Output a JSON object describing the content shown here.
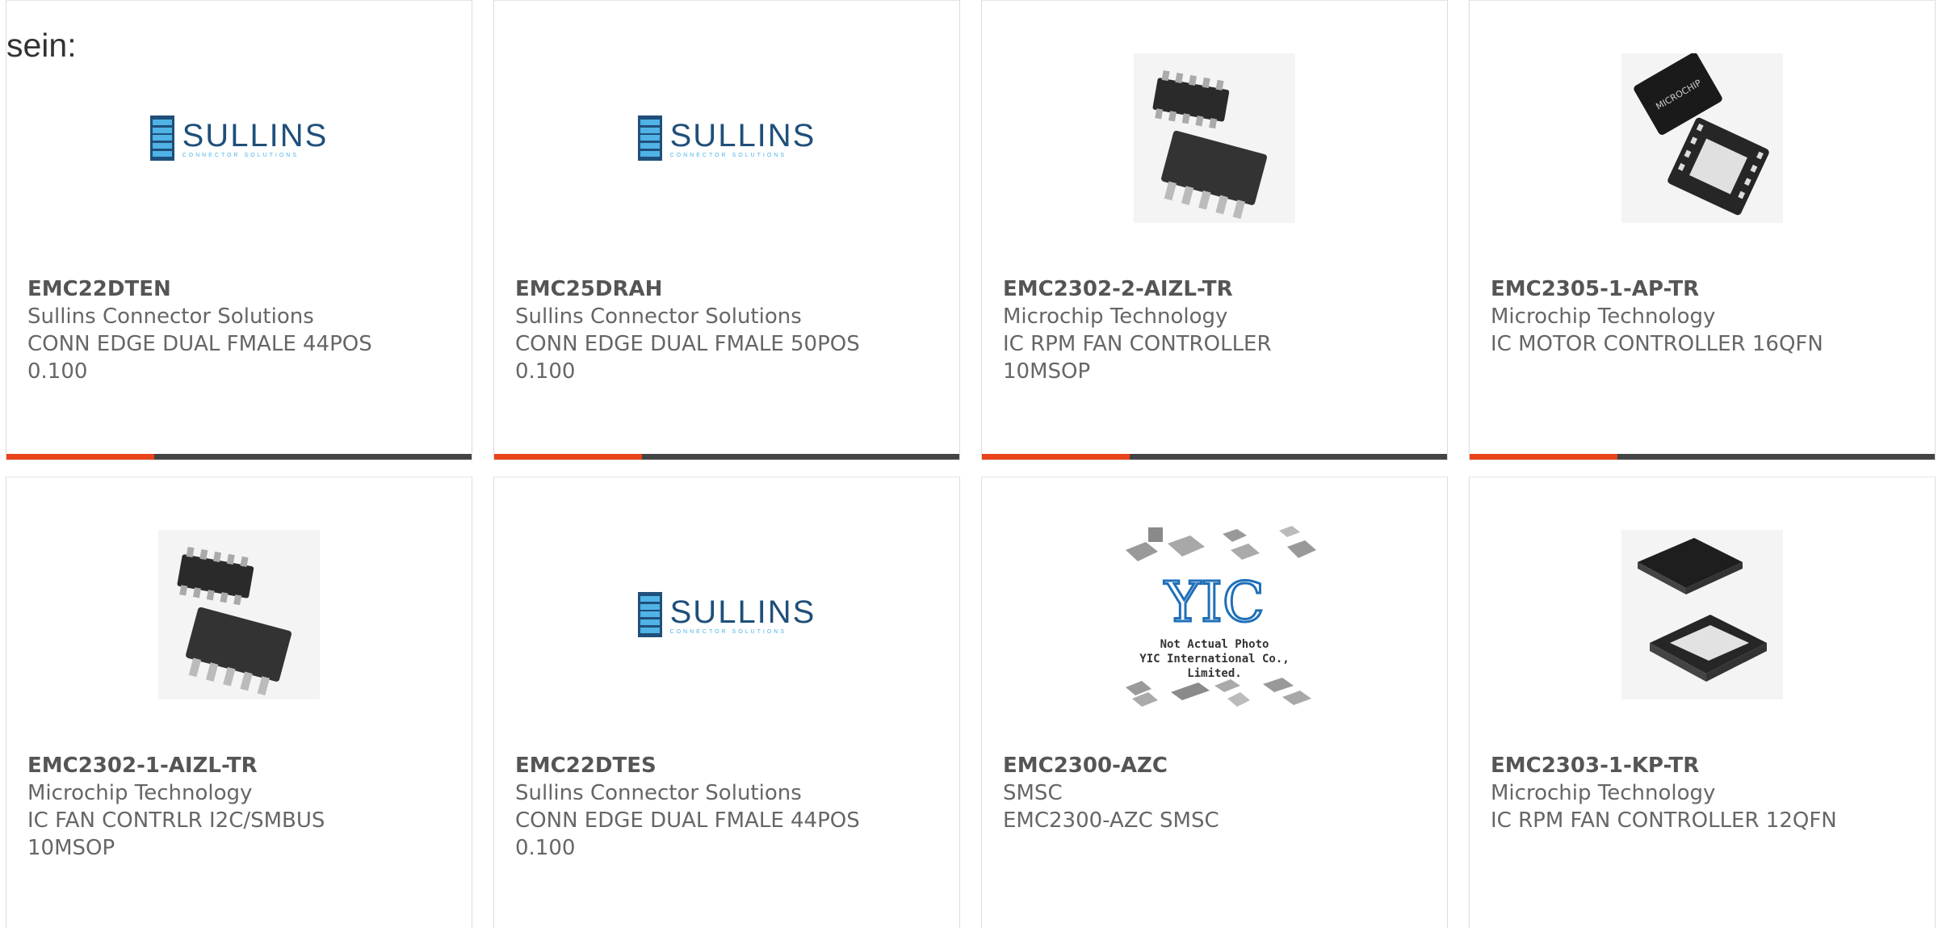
{
  "intro": "sein:",
  "colors": {
    "accent": "#e8431a",
    "bar": "#444444",
    "card_border": "#dcdcdc"
  },
  "products": [
    {
      "part_number": "EMC22DTEN",
      "manufacturer": "Sullins Connector Solutions",
      "description": "CONN EDGE DUAL FMALE 44POS 0.100",
      "image": "sullins-logo"
    },
    {
      "part_number": "EMC25DRAH",
      "manufacturer": "Sullins Connector Solutions",
      "description": "CONN EDGE DUAL FMALE 50POS 0.100",
      "image": "sullins-logo"
    },
    {
      "part_number": "EMC2302-2-AIZL-TR",
      "manufacturer": "Microchip Technology",
      "description": "IC RPM FAN CONTROLLER 10MSOP",
      "image": "msop-chip"
    },
    {
      "part_number": "EMC2305-1-AP-TR",
      "manufacturer": "Microchip Technology",
      "description": "IC MOTOR CONTROLLER 16QFN",
      "image": "qfn-chip-microchip"
    },
    {
      "part_number": "EMC2302-1-AIZL-TR",
      "manufacturer": "Microchip Technology",
      "description": "IC FAN CONTRLR I2C/SMBUS 10MSOP",
      "image": "msop-chip"
    },
    {
      "part_number": "EMC22DTES",
      "manufacturer": "Sullins Connector Solutions",
      "description": "CONN EDGE DUAL FMALE 44POS 0.100",
      "image": "sullins-logo"
    },
    {
      "part_number": "EMC2300-AZC",
      "manufacturer": "SMSC",
      "description": "EMC2300-AZC SMSC",
      "image": "yic-placeholder"
    },
    {
      "part_number": "EMC2303-1-KP-TR",
      "manufacturer": "Microchip Technology",
      "description": "IC RPM FAN CONTROLLER 12QFN",
      "image": "qfn-chip"
    }
  ],
  "sullins_logo": {
    "name": "SULLINS",
    "tagline": "CONNECTOR SOLUTIONS"
  },
  "yic_placeholder": {
    "line1": "Not Actual Photo",
    "line2": "YIC International Co., Limited."
  }
}
